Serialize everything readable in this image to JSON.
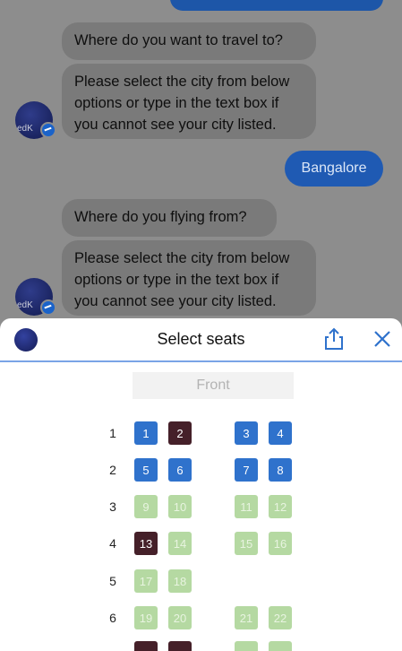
{
  "chat": {
    "messages": [
      {
        "text": "Where do you want to travel to?"
      },
      {
        "text": "Please select the city from below options or type in the text box if you cannot see your city listed."
      },
      {
        "text": "Bangalore"
      },
      {
        "text": "Where do you flying from?"
      },
      {
        "text": "Please select the city from below options or type in the text box if you cannot see your city listed."
      }
    ],
    "avatar_text": "edK"
  },
  "sheet": {
    "title": "Select seats",
    "front_label": "Front",
    "rows": [
      {
        "num": "1",
        "seats": [
          {
            "label": "1",
            "state": "available"
          },
          {
            "label": "2",
            "state": "taken"
          },
          {
            "label": "3",
            "state": "available"
          },
          {
            "label": "4",
            "state": "available"
          }
        ]
      },
      {
        "num": "2",
        "seats": [
          {
            "label": "5",
            "state": "available"
          },
          {
            "label": "6",
            "state": "available"
          },
          {
            "label": "7",
            "state": "available"
          },
          {
            "label": "8",
            "state": "available"
          }
        ]
      },
      {
        "num": "3",
        "seats": [
          {
            "label": "9",
            "state": "green"
          },
          {
            "label": "10",
            "state": "green"
          },
          {
            "label": "11",
            "state": "green"
          },
          {
            "label": "12",
            "state": "green"
          }
        ]
      },
      {
        "num": "4",
        "seats": [
          {
            "label": "13",
            "state": "taken"
          },
          {
            "label": "14",
            "state": "green"
          },
          {
            "label": "15",
            "state": "green"
          },
          {
            "label": "16",
            "state": "green"
          }
        ]
      },
      {
        "num": "5",
        "seats": [
          {
            "label": "17",
            "state": "green"
          },
          {
            "label": "18",
            "state": "green"
          }
        ]
      },
      {
        "num": "6",
        "seats": [
          {
            "label": "19",
            "state": "green"
          },
          {
            "label": "20",
            "state": "green"
          },
          {
            "label": "21",
            "state": "green"
          },
          {
            "label": "22",
            "state": "green"
          }
        ]
      }
    ]
  },
  "icons": {
    "share": "share-icon",
    "close": "close-icon"
  },
  "colors": {
    "accent": "#2f72cc",
    "taken": "#452029",
    "green": "#b5d9a2",
    "user_bubble": "#1f5ab3"
  }
}
